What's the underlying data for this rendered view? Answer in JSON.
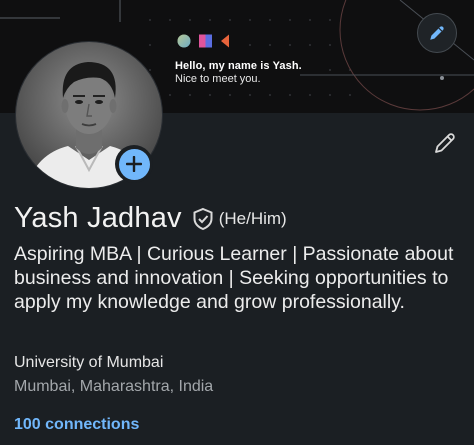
{
  "banner": {
    "headline": "Hello, my name is Yash.",
    "subline": "Nice to meet you."
  },
  "profile": {
    "name": "Yash Jadhav",
    "pronouns": "(He/Him)",
    "headline": "Aspiring MBA | Curious Learner | Passionate about business and innovation | Seeking opportunities to apply my knowledge and grow professionally.",
    "education": "University of Mumbai",
    "location": "Mumbai, Maharashtra, India",
    "connections": "100 connections"
  },
  "icons": {
    "banner_edit": "pencil-icon",
    "profile_edit": "pencil-icon",
    "add_photo": "plus-icon",
    "verified": "shield-check-icon"
  },
  "colors": {
    "background": "#1b1f23",
    "banner": "#0f0f10",
    "accent": "#71b7fb",
    "shape_green": "#7fc9a8",
    "shape_blue": "#5b6ee1",
    "shape_orange": "#e8643c"
  }
}
